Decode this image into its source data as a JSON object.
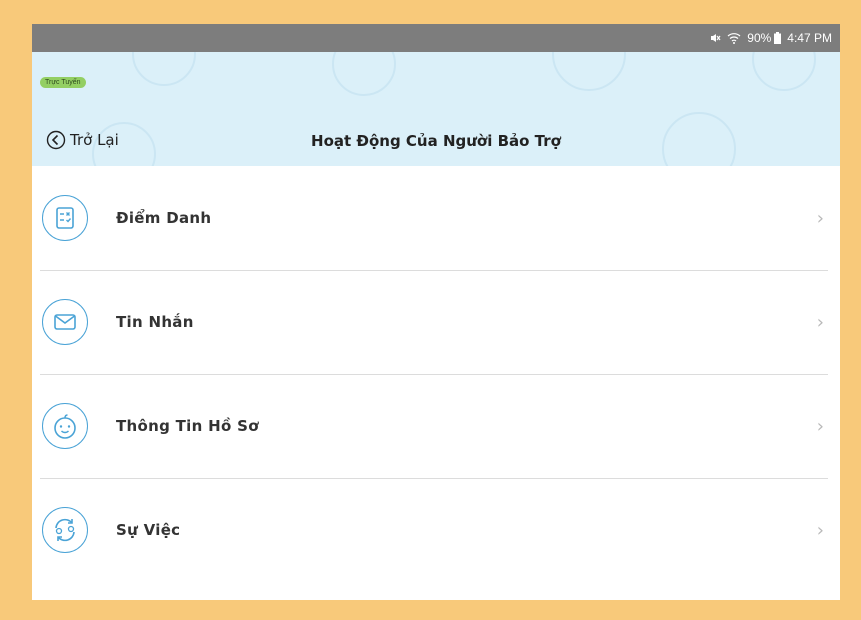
{
  "status_bar": {
    "battery": "90%",
    "time": "4:47 PM",
    "icons": [
      "mute-icon",
      "wifi-icon",
      "battery-icon"
    ]
  },
  "header": {
    "badge": "Trực Tuyến",
    "back_label": "Trở Lại",
    "title": "Hoạt Động Của Người Bảo Trợ"
  },
  "menu": {
    "items": [
      {
        "label": "Điểm Danh",
        "icon": "attendance-icon"
      },
      {
        "label": "Tin Nhắn",
        "icon": "mail-icon"
      },
      {
        "label": "Thông Tin Hồ Sơ",
        "icon": "baby-face-icon"
      },
      {
        "label": "Sự Việc",
        "icon": "exchange-icon"
      }
    ]
  },
  "colors": {
    "frame": "#f8c97a",
    "status_bar": "#7d7d7d",
    "header_bg": "#dbf0f9",
    "accent": "#4aa3d6",
    "badge": "#93cf63"
  }
}
